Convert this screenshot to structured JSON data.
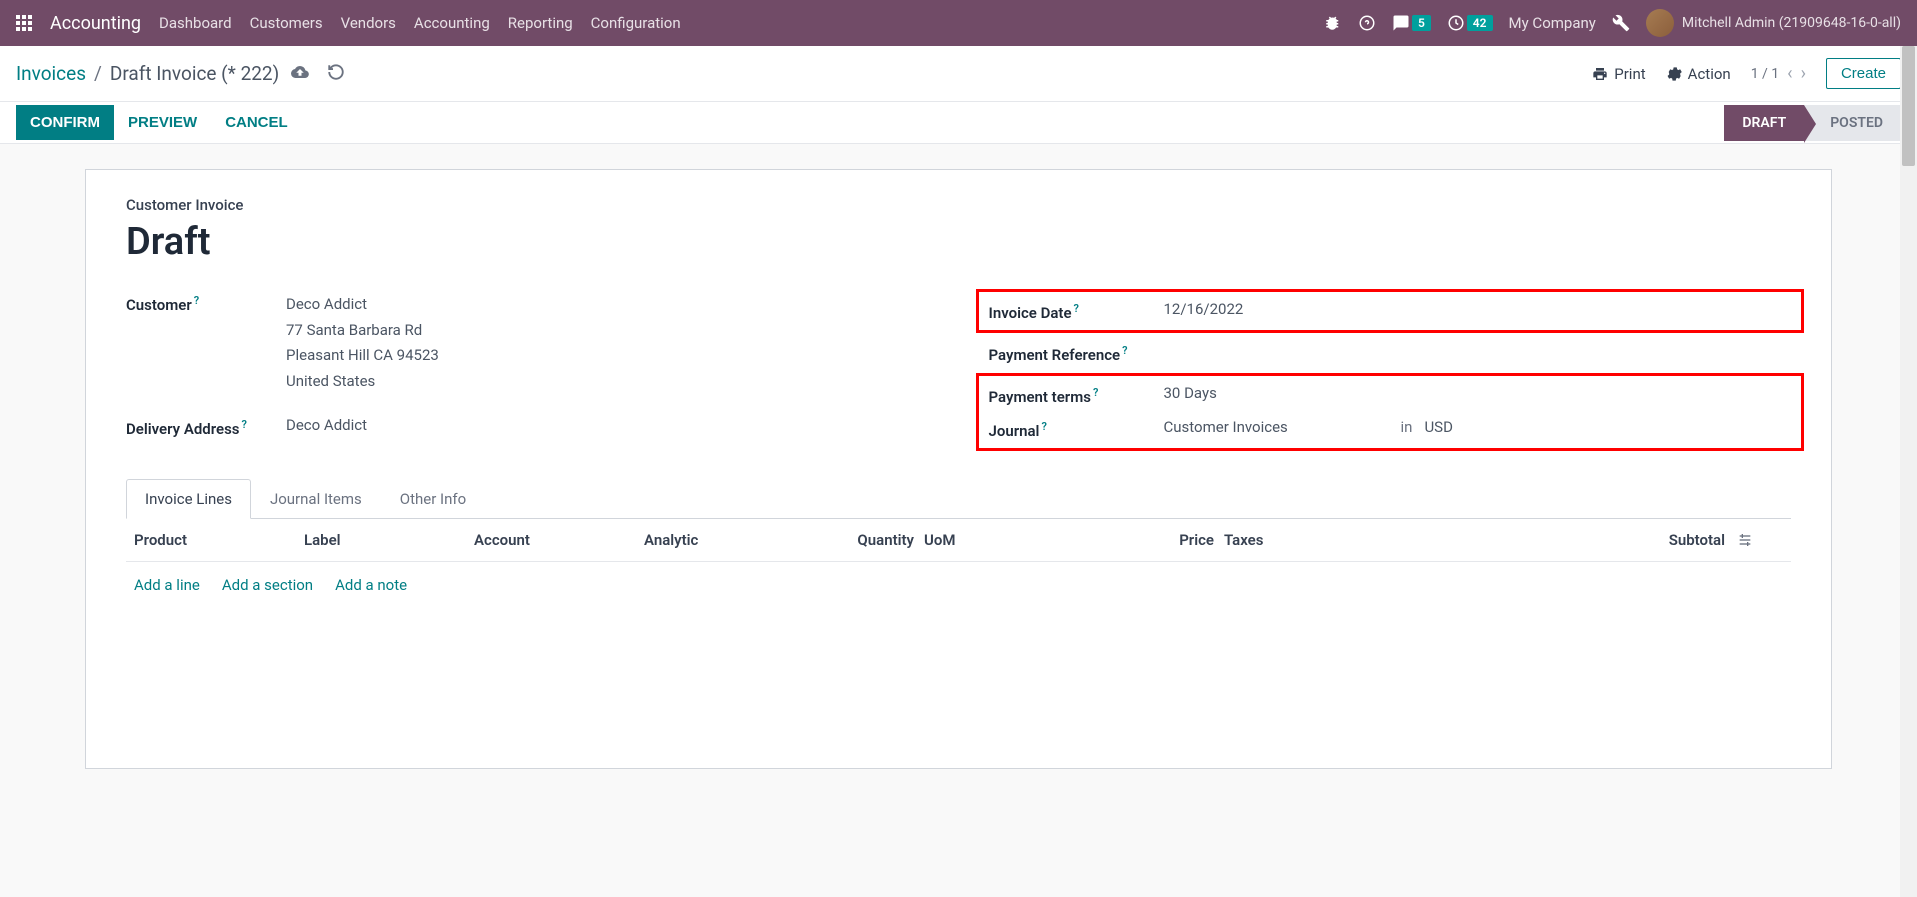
{
  "topbar": {
    "app_name": "Accounting",
    "nav": [
      "Dashboard",
      "Customers",
      "Vendors",
      "Accounting",
      "Reporting",
      "Configuration"
    ],
    "msg_count": "5",
    "activity_count": "42",
    "company": "My Company",
    "user": "Mitchell Admin (21909648-16-0-all)"
  },
  "subbar": {
    "breadcrumb_root": "Invoices",
    "breadcrumb_sep": "/",
    "breadcrumb_current": "Draft Invoice (* 222)",
    "print": "Print",
    "action": "Action",
    "pager": "1 / 1",
    "create": "Create"
  },
  "actionbar": {
    "confirm": "CONFIRM",
    "preview": "PREVIEW",
    "cancel": "CANCEL",
    "status_draft": "DRAFT",
    "status_posted": "POSTED"
  },
  "sheet": {
    "header_label": "Customer Invoice",
    "title": "Draft",
    "labels": {
      "customer": "Customer",
      "delivery": "Delivery Address",
      "invoice_date": "Invoice Date",
      "payment_ref": "Payment Reference",
      "payment_terms": "Payment terms",
      "journal": "Journal"
    },
    "values": {
      "customer_name": "Deco Addict",
      "addr1": "77 Santa Barbara Rd",
      "addr2": "Pleasant Hill CA 94523",
      "addr3": "United States",
      "delivery": "Deco Addict",
      "invoice_date": "12/16/2022",
      "payment_terms": "30 Days",
      "journal": "Customer Invoices",
      "journal_in": "in",
      "currency": "USD"
    },
    "tabs": [
      "Invoice Lines",
      "Journal Items",
      "Other Info"
    ],
    "columns": {
      "product": "Product",
      "label": "Label",
      "account": "Account",
      "analytic": "Analytic",
      "quantity": "Quantity",
      "uom": "UoM",
      "price": "Price",
      "taxes": "Taxes",
      "subtotal": "Subtotal"
    },
    "add_links": {
      "line": "Add a line",
      "section": "Add a section",
      "note": "Add a note"
    }
  }
}
